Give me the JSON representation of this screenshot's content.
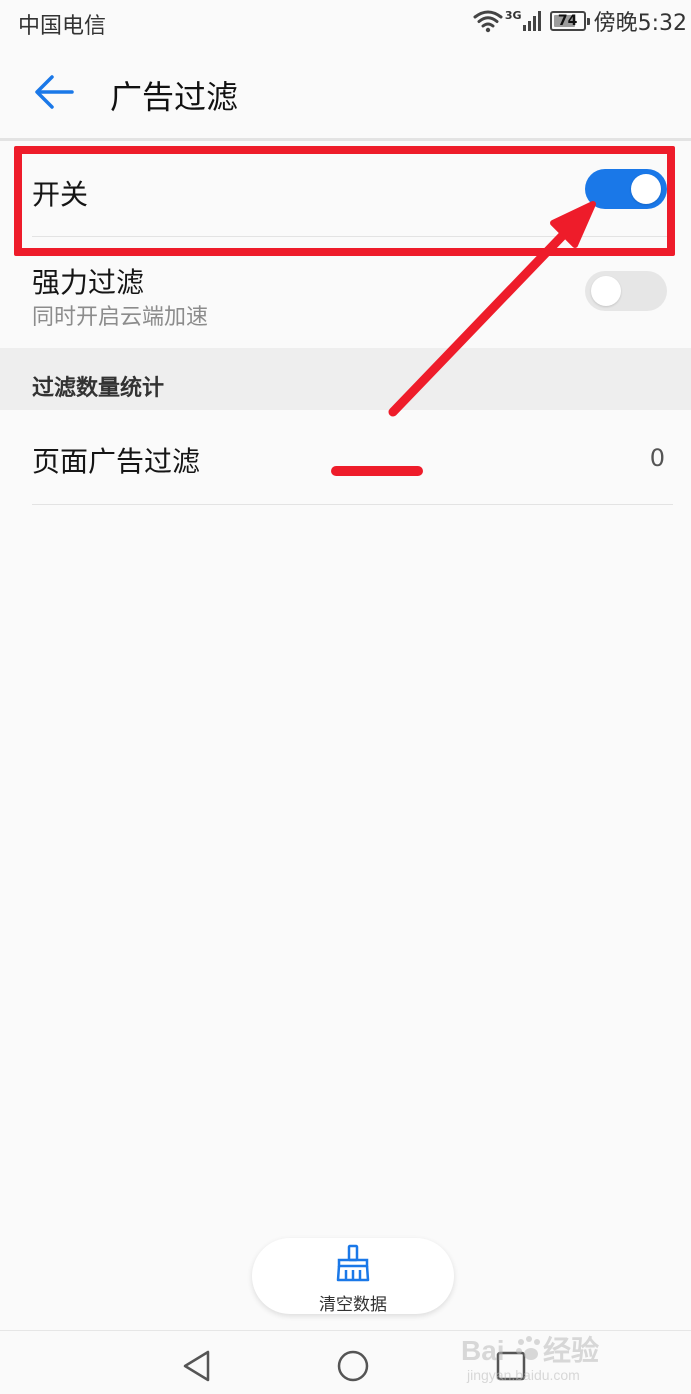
{
  "status_bar": {
    "carrier": "中国电信",
    "network": "3G",
    "battery_level": "74",
    "time": "傍晚5:32",
    "icons": [
      "wifi-icon",
      "signal-icon",
      "battery-icon"
    ]
  },
  "header": {
    "title": "广告过滤",
    "back_icon": "arrow-left-icon"
  },
  "settings": [
    {
      "title": "开关",
      "subtitle": "",
      "toggle_on": true
    },
    {
      "title": "强力过滤",
      "subtitle": "同时开启云端加速",
      "toggle_on": false
    }
  ],
  "stats": {
    "section_label": "过滤数量统计",
    "items": [
      {
        "label": "页面广告过滤",
        "value": "0"
      }
    ]
  },
  "clear_button": {
    "label": "清空数据",
    "icon": "broom-icon"
  },
  "nav": {
    "icons": [
      "back-triangle-icon",
      "home-circle-icon",
      "recents-square-icon"
    ]
  },
  "colors": {
    "accent": "#1a78e8",
    "annotation": "#ee1c2a",
    "background": "#fafafa",
    "section_background": "#eeeeee"
  }
}
